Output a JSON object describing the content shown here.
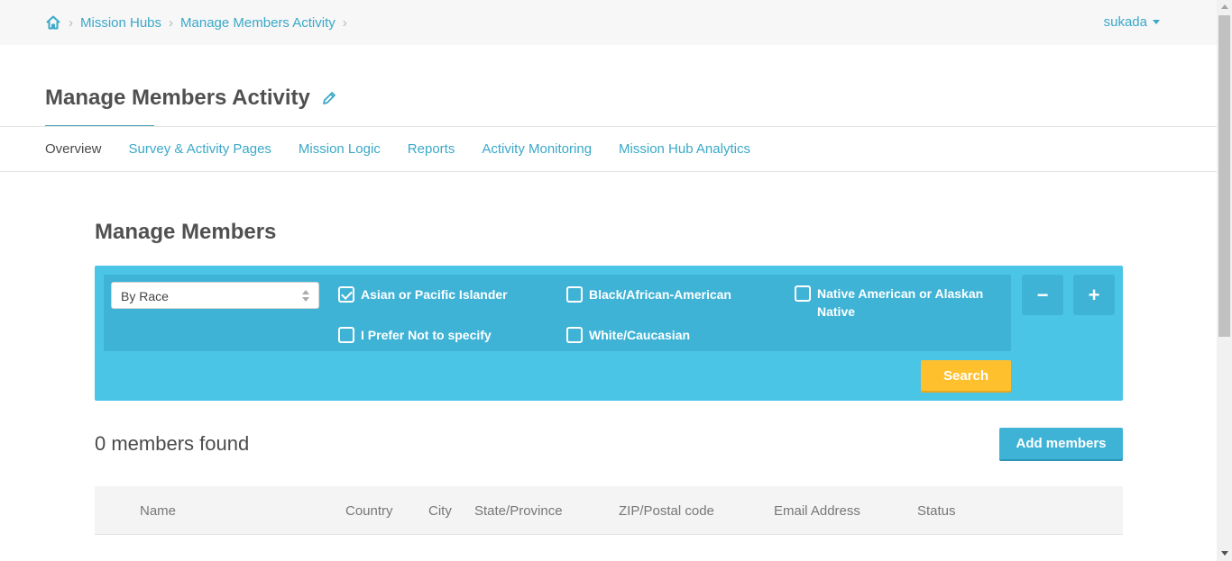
{
  "breadcrumb": {
    "items": [
      "Mission Hubs",
      "Manage Members Activity"
    ]
  },
  "user": {
    "name": "sukada"
  },
  "page": {
    "title": "Manage Members Activity"
  },
  "tabs": [
    {
      "label": "Overview",
      "active": true
    },
    {
      "label": "Survey & Activity Pages",
      "active": false
    },
    {
      "label": "Mission Logic",
      "active": false
    },
    {
      "label": "Reports",
      "active": false
    },
    {
      "label": "Activity Monitoring",
      "active": false
    },
    {
      "label": "Mission Hub Analytics",
      "active": false
    }
  ],
  "section": {
    "title": "Manage Members"
  },
  "filter": {
    "select_value": "By Race",
    "options": [
      {
        "label": "Asian or Pacific Islander",
        "checked": true
      },
      {
        "label": "Black/African-American",
        "checked": false
      },
      {
        "label": "Native American or Alaskan Native",
        "checked": false
      },
      {
        "label": "I Prefer Not to specify",
        "checked": false
      },
      {
        "label": "White/Caucasian",
        "checked": false
      }
    ],
    "minus_label": "−",
    "plus_label": "+",
    "search_label": "Search"
  },
  "results": {
    "count_text": "0 members found",
    "add_label": "Add members"
  },
  "table": {
    "columns": [
      "Name",
      "Country",
      "City",
      "State/Province",
      "ZIP/Postal code",
      "Email Address",
      "Status"
    ]
  },
  "colors": {
    "accent": "#3aa8c8",
    "panel": "#4bc5e6",
    "search_button": "#ffc02e"
  }
}
